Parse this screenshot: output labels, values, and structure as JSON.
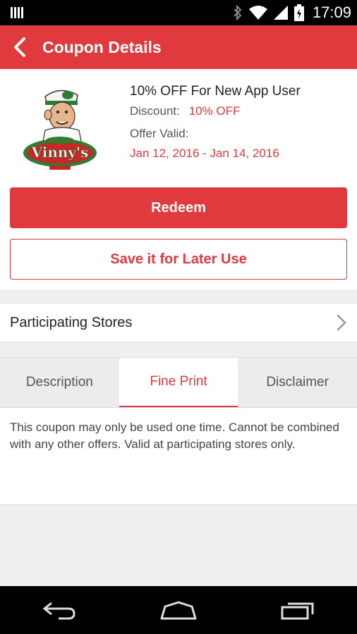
{
  "status_bar": {
    "time": "17:09",
    "icons": [
      "bars-icon",
      "bluetooth-icon",
      "wifi-icon",
      "signal-icon",
      "battery-icon"
    ]
  },
  "app_bar": {
    "title": "Coupon Details",
    "color": "#e03a3e"
  },
  "coupon": {
    "title": "10% OFF For New App User",
    "discount_label": "Discount:",
    "discount_value": "10% OFF",
    "valid_label": "Offer Valid:",
    "valid_dates": "Jan 12, 2016 - Jan 14, 2016",
    "redeem_label": "Redeem",
    "save_label": "Save it for Later Use"
  },
  "stores": {
    "label": "Participating Stores"
  },
  "tabs": [
    {
      "label": "Description",
      "active": false
    },
    {
      "label": "Fine Print",
      "active": true
    },
    {
      "label": "Disclaimer",
      "active": false
    }
  ],
  "tab_content": "This coupon may only be used one time. Cannot be combined with any other offers. Valid at participating stores only."
}
